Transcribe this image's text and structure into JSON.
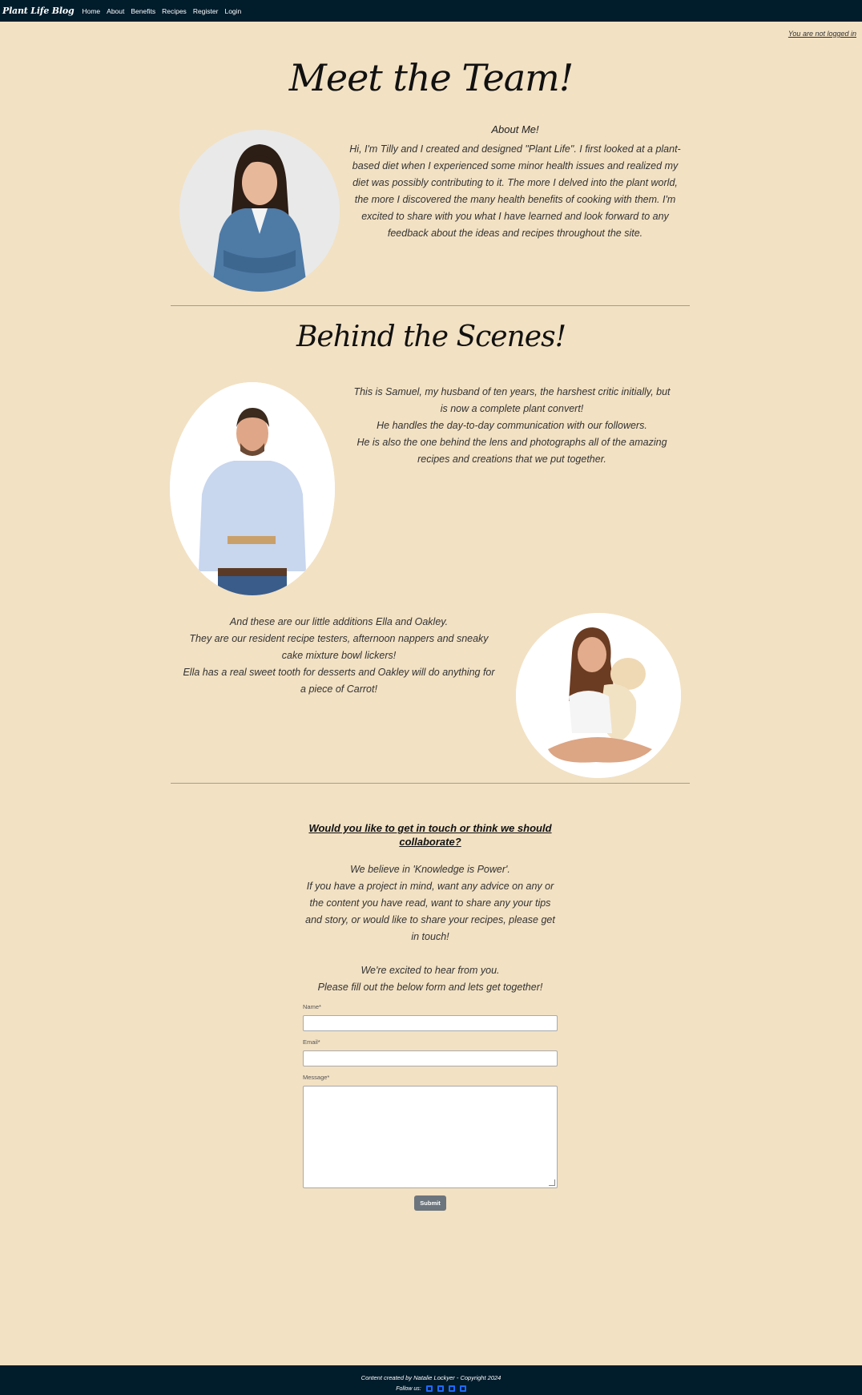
{
  "nav": {
    "brand": "Plant Life Blog",
    "links": [
      "Home",
      "About",
      "Benefits",
      "Recipes",
      "Register",
      "Login"
    ]
  },
  "login_status": "You are not logged in",
  "team": {
    "heading": "Meet the Team!",
    "about_title": "About Me!",
    "about_text": "Hi, I'm Tilly and I created and designed \"Plant Life\". I first looked at a plant-based diet when I experienced some minor health issues and realized my diet was possibly contributing to it. The more I delved into the plant world, the more I discovered the many health benefits of cooking with them. I'm excited to share with you what I have learned and look forward to any feedback about the ideas and recipes throughout the site."
  },
  "behind": {
    "heading": "Behind the Scenes!",
    "samuel_lines": [
      "This is Samuel, my husband of ten years, the harshest critic initially, but is now a complete plant convert!",
      "He handles the day-to-day communication with our followers.",
      "He is also the one behind the lens and photographs all of the amazing recipes and creations that we put together."
    ],
    "ella_lines": [
      "And these are our little additions Ella and Oakley.",
      "They are our resident recipe testers, afternoon nappers and sneaky cake mixture bowl lickers!",
      "Ella has a real sweet tooth for desserts and Oakley will do anything for a piece of Carrot!"
    ]
  },
  "contact": {
    "heading": "Would you like to get in touch or think we should collaborate?",
    "lines": [
      "We believe in 'Knowledge is Power'.",
      "If you have a project in mind, want any advice on any or the content you have read, want to share any your tips and story, or would like to share your recipes, please get in touch!",
      "",
      "We're excited to hear from you.",
      "Please fill out the below form and lets get together!"
    ],
    "name_label": "Name*",
    "email_label": "Email*",
    "message_label": "Message*",
    "name_value": "",
    "email_value": "",
    "message_value": "",
    "submit_label": "Submit"
  },
  "footer": {
    "credit": "Content created by Natalie Lockyer - Copyright 2024",
    "follow_label": "Follow us:",
    "social_icons": [
      "facebook-icon",
      "twitter-icon",
      "linkedin-icon",
      "youtube-icon"
    ]
  },
  "colors": {
    "background": "#f2e1c3",
    "navbar": "#011c2b",
    "submit": "#6c757d",
    "social": "#1e6bff"
  }
}
